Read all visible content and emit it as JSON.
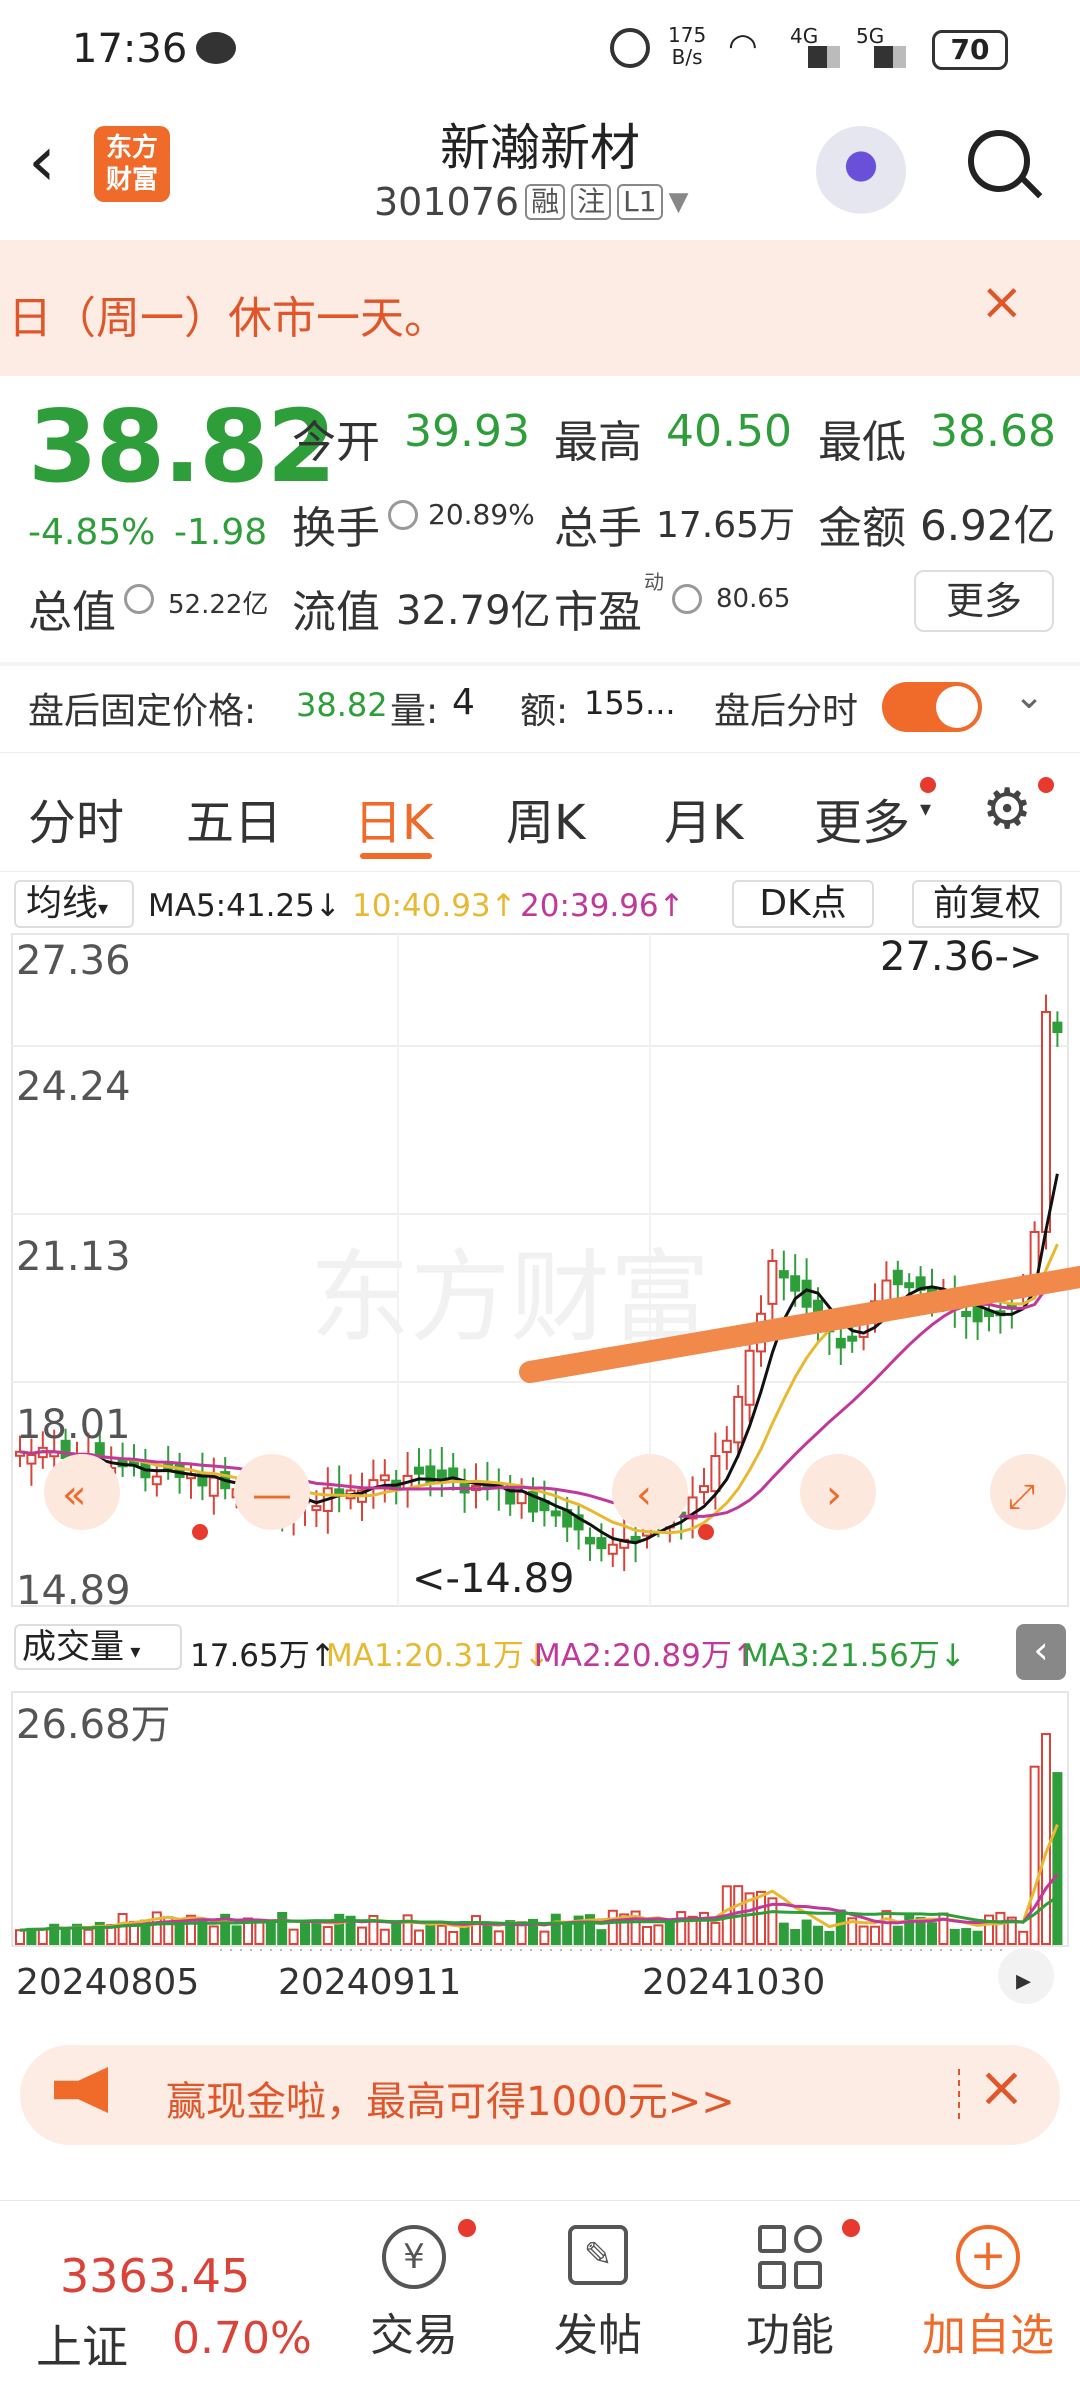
{
  "status": {
    "time": "17:36",
    "net_speed_top": "175",
    "net_speed_bottom": "B/s",
    "sig1": "4G",
    "sig2": "5G",
    "battery": "70"
  },
  "header": {
    "title": "新瀚新材",
    "code": "301076",
    "tag1": "融",
    "tag2": "注",
    "tag3": "L1",
    "logo_line1": "东方",
    "logo_line2": "财富"
  },
  "notice": {
    "text": "日（周一）休市一天。"
  },
  "quote": {
    "price": "38.82",
    "change_pct": "-4.85%",
    "change": "-1.98",
    "open_label": "今开",
    "open": "39.93",
    "high_label": "最高",
    "high": "40.50",
    "low_label": "最低",
    "low": "38.68",
    "turnover_label": "换手",
    "turnover": "20.89%",
    "volume_label": "总手",
    "volume": "17.65万",
    "amount_label": "金额",
    "amount": "6.92亿",
    "mcap_label": "总值",
    "mcap": "52.22亿",
    "float_label": "流值",
    "float": "32.79亿",
    "pe_label": "市盈",
    "pe_sup": "动",
    "pe": "80.65",
    "more_button": "更多",
    "after_label": "盘后固定价格:",
    "after_price": "38.82",
    "after_vol_label": "量:",
    "after_vol": "4",
    "after_amt_label": "额:",
    "after_amt": "155...",
    "after_tick_label": "盘后分时"
  },
  "tabs": [
    "分时",
    "五日",
    "日K",
    "周K",
    "月K",
    "更多"
  ],
  "kline": {
    "ma_selector": "均线",
    "ma5": "MA5:41.25↓",
    "ma10": "10:40.93↑",
    "ma20": "20:39.96↑",
    "dk_button": "DK点",
    "adjust_button": "前复权",
    "y_labels": [
      "27.36",
      "24.24",
      "21.13",
      "18.01",
      "14.89"
    ],
    "high_marker": "27.36->",
    "low_marker": "<-14.89",
    "vol_selector": "成交量",
    "vol_value": "17.65万↑",
    "vol_ma1": "MA1:20.31万↓",
    "vol_ma2": "MA2:20.89万↑",
    "vol_ma3": "MA3:21.56万↓",
    "vol_max": "26.68万",
    "dates": [
      "20240805",
      "20240911",
      "20241030"
    ]
  },
  "colors": {
    "up": "#d9433a",
    "down": "#2e9e3a",
    "accent": "#f06a2a",
    "ma5": "#111111",
    "ma10": "#e8b930",
    "ma20": "#c0389a"
  },
  "promo": {
    "text": "赢现金啦，最高可得1000元>>"
  },
  "bottom": {
    "index_value": "3363.45",
    "index_name": "上证",
    "index_pct": "0.70%",
    "trade": "交易",
    "post": "发帖",
    "func": "功能",
    "add": "加自选"
  }
}
